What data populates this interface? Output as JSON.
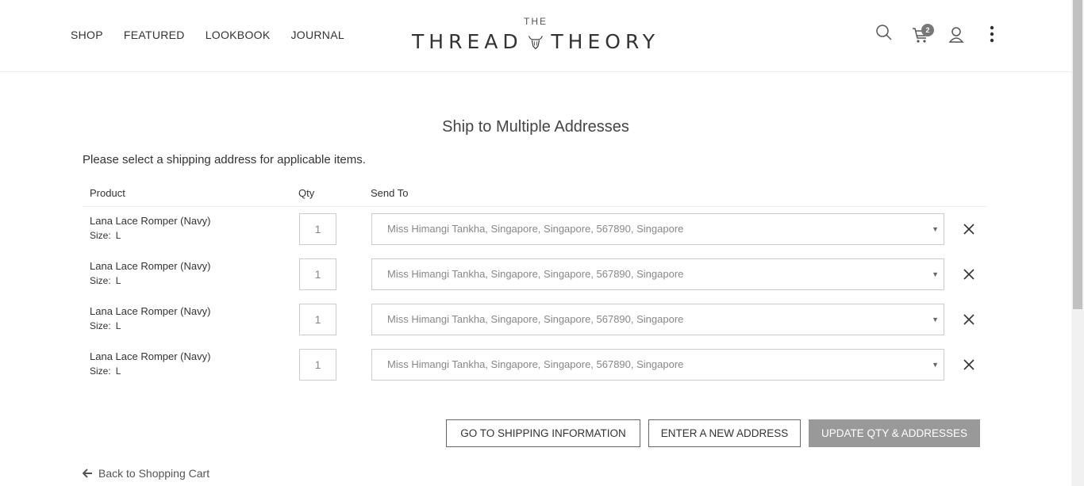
{
  "header": {
    "nav": [
      "SHOP",
      "FEATURED",
      "LOOKBOOK",
      "JOURNAL"
    ],
    "logo_small": "THE",
    "logo_left": "THREAD",
    "logo_right": "THEORY",
    "cart_count": "2",
    "icons": [
      "search-icon",
      "cart-icon",
      "user-icon",
      "more-vertical-icon"
    ]
  },
  "page": {
    "title": "Ship to Multiple Addresses",
    "intro": "Please select a shipping address for applicable items."
  },
  "table": {
    "headers": {
      "product": "Product",
      "qty": "Qty",
      "send_to": "Send To"
    },
    "size_label": "Size:",
    "rows": [
      {
        "product": "Lana Lace Romper (Navy)",
        "size": "L",
        "qty": "1",
        "address": "Miss Himangi Tankha, Singapore, Singapore, 567890, Singapore"
      },
      {
        "product": "Lana Lace Romper (Navy)",
        "size": "L",
        "qty": "1",
        "address": "Miss Himangi Tankha, Singapore, Singapore, 567890, Singapore"
      },
      {
        "product": "Lana Lace Romper (Navy)",
        "size": "L",
        "qty": "1",
        "address": "Miss Himangi Tankha, Singapore, Singapore, 567890, Singapore"
      },
      {
        "product": "Lana Lace Romper (Navy)",
        "size": "L",
        "qty": "1",
        "address": "Miss Himangi Tankha, Singapore, Singapore, 567890, Singapore"
      }
    ]
  },
  "actions": {
    "go_shipping": "GO TO SHIPPING INFORMATION",
    "new_address": "ENTER A NEW ADDRESS",
    "update": "UPDATE QTY & ADDRESSES",
    "back": "Back to Shopping Cart"
  },
  "colors": {
    "primary_button": "#999999",
    "text": "#333333",
    "border": "#cccccc"
  }
}
